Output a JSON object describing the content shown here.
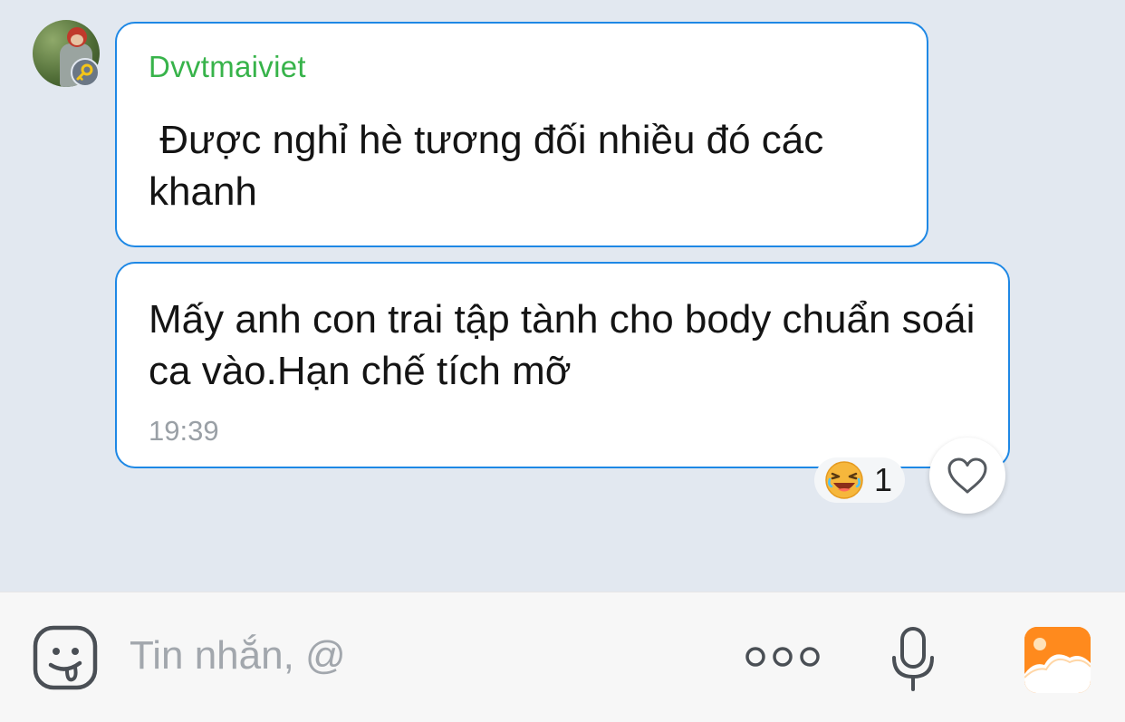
{
  "messages": [
    {
      "sender": "Dvvtmaiviet",
      "text": " Được nghỉ hè tương đối nhiều đó các khanh"
    },
    {
      "text": "Mấy anh con trai tập tành cho body chuẩn soái ca vào.Hạn chế tích mỡ",
      "time": "19:39",
      "reaction": {
        "icon": "laughing-emoji-icon",
        "count": "1"
      }
    }
  ],
  "input": {
    "placeholder": "Tin nhắn, @"
  },
  "colors": {
    "chat_background": "#e2e8f0",
    "bubble_border": "#1e88e5",
    "sender_name": "#37b34a",
    "image_button": "#ff8a1d"
  }
}
